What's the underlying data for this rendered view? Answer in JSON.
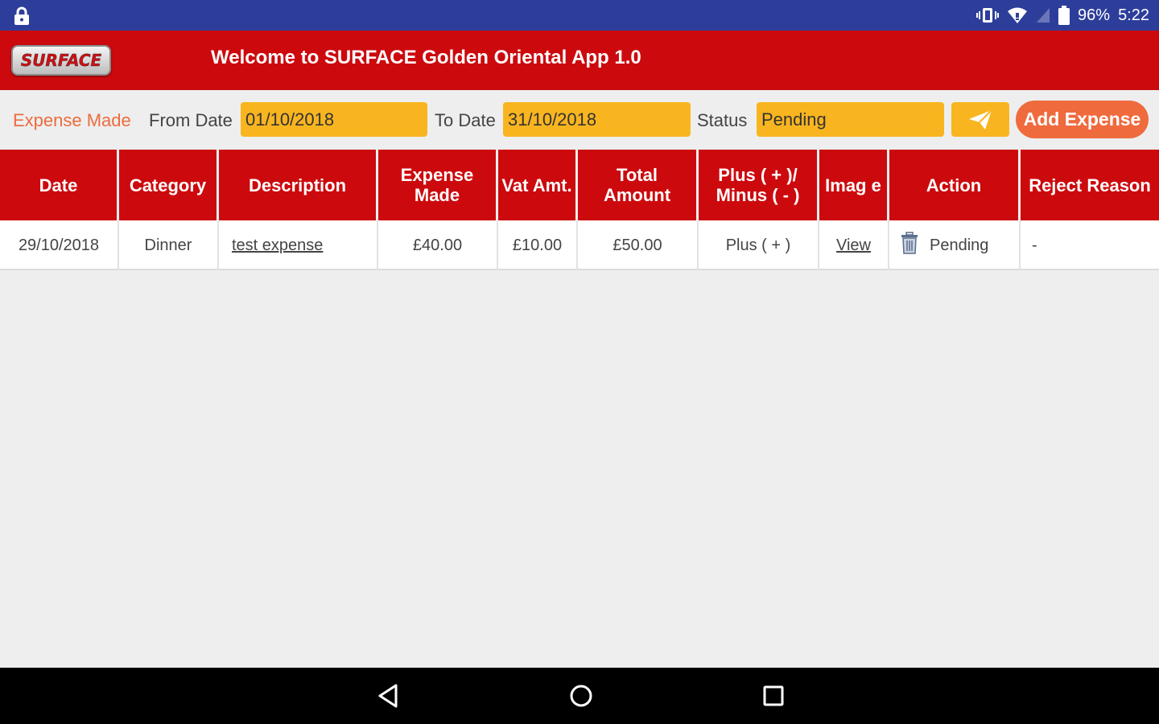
{
  "status_bar": {
    "battery": "96%",
    "time": "5:22",
    "icons": [
      "lock-icon",
      "vibrate-icon",
      "wifi-icon",
      "no-signal-icon",
      "battery-icon"
    ]
  },
  "header": {
    "logo_text": "SURFACE",
    "title": "Welcome to SURFACE Golden Oriental App 1.0"
  },
  "filters": {
    "section_label": "Expense Made",
    "from_label": "From Date",
    "from_value": "01/10/2018",
    "to_label": "To Date",
    "to_value": "31/10/2018",
    "status_label": "Status",
    "status_value": "Pending",
    "send_icon": "paper-plane-icon",
    "add_button": "Add Expense"
  },
  "table": {
    "columns": [
      "Date",
      "Category",
      "Description",
      "Expense Made",
      "Vat Amt.",
      "Total Amount",
      "Plus ( + )/ Minus ( - )",
      "Imag e",
      "Action",
      "Reject Reason"
    ],
    "rows": [
      {
        "date": "29/10/2018",
        "category": "Dinner",
        "description": "test expense",
        "expense_made": "£40.00",
        "vat_amt": "£10.00",
        "total_amount": "£50.00",
        "plus_minus": "Plus ( + )",
        "image": "View",
        "action_icon": "trash-icon",
        "action": "Pending",
        "reject_reason": "-"
      }
    ]
  },
  "colors": {
    "status_bar": "#2d3e9a",
    "header_red": "#cc0a0e",
    "field_yellow": "#f9b51f",
    "accent_orange": "#ef6a3d"
  },
  "nav_bar": {
    "icons": [
      "back-icon",
      "home-icon",
      "recents-icon"
    ]
  }
}
